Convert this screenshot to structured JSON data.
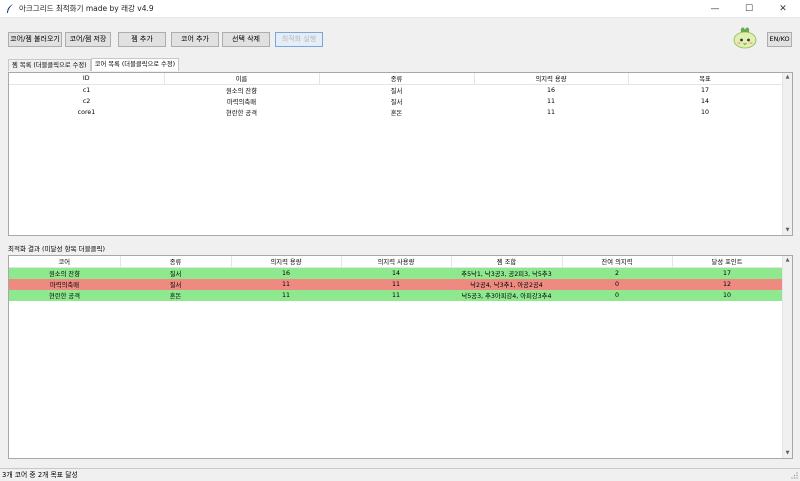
{
  "window": {
    "title": "아크그리드 최적화기 made by 래강 v4.9",
    "minimize_glyph": "—",
    "maximize_glyph": "☐",
    "close_glyph": "✕"
  },
  "toolbar": {
    "load_label": "코어/젬 불러오기",
    "save_label": "코어/젬 저장",
    "add_gem_label": "젬 추가",
    "add_core_label": "코어 추가",
    "delete_label": "선택 삭제",
    "optimize_label": "최적화 실행",
    "lang_label": "EN/KO"
  },
  "tabs": [
    {
      "label": "젬 목록 (더블클릭으로 수정)"
    },
    {
      "label": "코어 목록 (더블클릭으로 수정)"
    }
  ],
  "core_table": {
    "columns": [
      "ID",
      "이름",
      "종류",
      "의지력 용량",
      "목표"
    ],
    "rows": [
      [
        "c1",
        "원소의 잔향",
        "질서",
        "16",
        "17"
      ],
      [
        "c2",
        "마력의축매",
        "질서",
        "11",
        "14"
      ],
      [
        "core1",
        "현란한 공격",
        "혼돈",
        "11",
        "10"
      ]
    ]
  },
  "results": {
    "label": "최적화 결과 (미달성 항목 더블클릭)",
    "columns": [
      "코어",
      "종류",
      "의지력 용량",
      "의지력 사용량",
      "젬 조합",
      "잔여 의지력",
      "달성 포인트"
    ],
    "rows": [
      {
        "status": "ok",
        "cells": [
          "원소의 잔향",
          "질서",
          "16",
          "14",
          "추5낙1, 낙3공3, 공2피3, 낙5추3",
          "2",
          "17"
        ]
      },
      {
        "status": "fail",
        "cells": [
          "마력의축매",
          "질서",
          "11",
          "11",
          "낙2공4, 낙3추1, 아공2공4",
          "0",
          "12"
        ]
      },
      {
        "status": "ok",
        "cells": [
          "현란한 공격",
          "혼돈",
          "11",
          "11",
          "낙5공3, 추3아피강4, 아피강3추4",
          "0",
          "10"
        ]
      }
    ]
  },
  "status_bar": {
    "text": "3개 코어 중 2개 목표 달성"
  },
  "colors": {
    "ok_row": "#8ee88e",
    "fail_row": "#ef8a80",
    "accent": "#0078d7"
  }
}
